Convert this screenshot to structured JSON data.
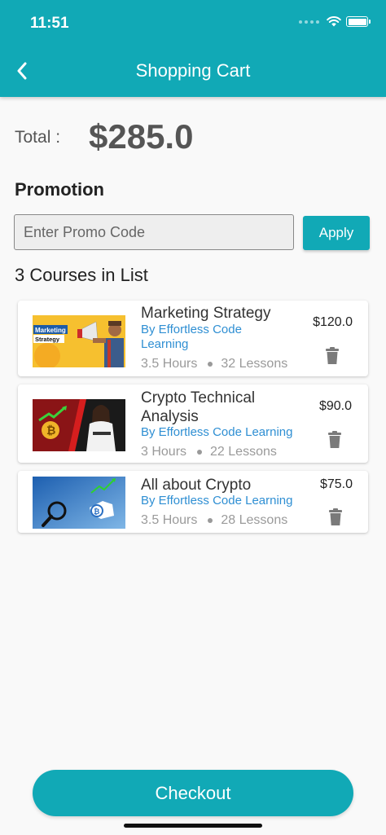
{
  "status_bar": {
    "time": "11:51"
  },
  "header": {
    "title": "Shopping Cart"
  },
  "total": {
    "label": "Total :",
    "value": "$285.0"
  },
  "promotion": {
    "title": "Promotion",
    "placeholder": "Enter Promo Code",
    "apply_label": "Apply"
  },
  "list": {
    "title": "3 Courses in List"
  },
  "courses": [
    {
      "title": "Marketing Strategy",
      "author": "By Effortless Code Learning",
      "hours": "3.5 Hours",
      "lessons": "32 Lessons",
      "price": "$120.0",
      "thumb_text_1": "Marketing",
      "thumb_text_2": "Strategy"
    },
    {
      "title": "Crypto Technical Analysis",
      "author": "By Effortless Code Learning",
      "hours": "3 Hours",
      "lessons": "22 Lessons",
      "price": "$90.0"
    },
    {
      "title": "All about Crypto",
      "author": "By Effortless Code Learning",
      "hours": "3.5 Hours",
      "lessons": "28 Lessons",
      "price": "$75.0"
    }
  ],
  "checkout": {
    "label": "Checkout"
  },
  "colors": {
    "accent": "#11a9b6",
    "link": "#2f8fd3"
  }
}
